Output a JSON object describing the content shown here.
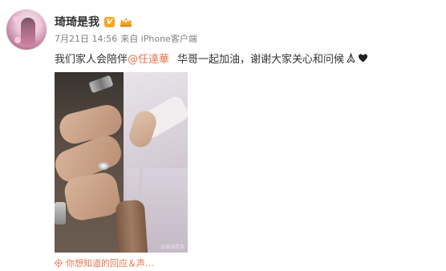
{
  "post": {
    "author": "琦琦是我",
    "verified_badge": "V",
    "time": "7月21日 14:56",
    "source": "来自 iPhone客户端",
    "text_before": "我们家人会陪伴",
    "mention": "@任達華",
    "text_after": "华哥一起加油，谢谢大家关心和问候",
    "photo_watermark": "@琦琦是我",
    "music_link": "你想知道的回应＆声…"
  },
  "icons": {
    "avatar": "profile-photo",
    "crown": "member-crown-icon",
    "emoji_pray": "pray-emoji-icon",
    "emoji_heart": "black-heart-emoji-icon",
    "music": "music-sparkle-icon"
  },
  "colors": {
    "accent": "#eb7350",
    "badge": "#f5a623",
    "meta": "#808080"
  }
}
